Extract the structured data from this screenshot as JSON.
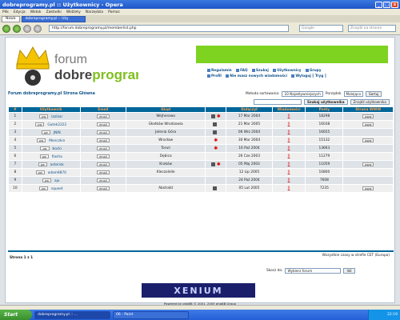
{
  "window": {
    "title": "dobreprogramy.pl :: Użytkownicy - Opera",
    "btn_min": "_",
    "btn_max": "□",
    "btn_close": "x"
  },
  "menu": [
    "Plik",
    "Edycja",
    "Widok",
    "Zakładki",
    "Widżety",
    "Narzędzia",
    "Pomoc"
  ],
  "tabs": [
    {
      "label": "Nowa"
    },
    {
      "label": "dobreprogramy.pl :: Uży"
    }
  ],
  "url": "http://forum.dobreprogramy.pl/memberlist.php",
  "search_placeholder_1": "Google",
  "search_placeholder_2": "Znajdź na stronie",
  "logo": {
    "line1": "forum",
    "line2a": "dobre",
    "line2b": "programy"
  },
  "toplinks": [
    {
      "label": "Regulamin"
    },
    {
      "label": "FAQ"
    },
    {
      "label": "Szukaj"
    },
    {
      "label": "Użytkownicy"
    },
    {
      "label": "Grupy"
    },
    {
      "label": "Profil"
    },
    {
      "label": "Nie masz nowych wiadomości"
    },
    {
      "label": "Wyloguj [ Tryg ]"
    }
  ],
  "site_link": "Forum dobreprogramy.pl Strona Główna",
  "sort": {
    "method_label": "Metoda sortowania:",
    "method_value": "10 Najaktywniejszych",
    "order_label": "Porządek",
    "order_value": "Malejąco",
    "sort_button": "Sortuj"
  },
  "user_search": {
    "button": "Szukaj użytkownika",
    "find_button": "Znajdź użytkownika"
  },
  "table": {
    "headers": [
      "#",
      "Użytkownik",
      "Email",
      "Skąd",
      "",
      "Dołączył",
      "Wiadomości",
      "Posty",
      "Strona WWW"
    ],
    "pm_label": "pw",
    "email_label": "email",
    "www_label": "www",
    "rows": [
      {
        "n": "1",
        "user": "lazikar",
        "from": "Wejherowo",
        "joined": "17 Mar 2004",
        "msgs": "0",
        "posts": "18298",
        "www": true,
        "gg": true,
        "star": true
      },
      {
        "n": "2",
        "user": "Gutek2222",
        "from": "Głodków Wrodzowia",
        "joined": "21 Mar 2005",
        "msgs": "0",
        "posts": "16038",
        "www": true,
        "gg": true,
        "star": false
      },
      {
        "n": "3",
        "user": "JNIN",
        "from": "Jelenia Góra",
        "joined": "06 Wrz 2004",
        "msgs": "0",
        "posts": "16655",
        "www": false,
        "gg": true,
        "star": false
      },
      {
        "n": "4",
        "user": "Monczkin",
        "from": "Wrocław",
        "joined": "30 Mar 2004",
        "msgs": "0",
        "posts": "15132",
        "www": true,
        "gg": false,
        "star": true
      },
      {
        "n": "5",
        "user": "bocki",
        "from": "Toruń",
        "joined": "16 Paź 2004",
        "msgs": "0",
        "posts": "13663",
        "www": false,
        "gg": false,
        "star": true
      },
      {
        "n": "6",
        "user": "fiasha",
        "from": "Dębica",
        "joined": "26 Cze 2003",
        "msgs": "0",
        "posts": "11279",
        "www": false,
        "gg": false,
        "star": false
      },
      {
        "n": "7",
        "user": "asterisk",
        "from": "Kraków",
        "joined": "05 Maj 2003",
        "msgs": "0",
        "posts": "11059",
        "www": true,
        "gg": true,
        "star": true
      },
      {
        "n": "8",
        "user": "adam9870",
        "from": "Kleczolelle",
        "joined": "12 Lip 2005",
        "msgs": "0",
        "posts": "10800",
        "www": false,
        "gg": false,
        "star": false
      },
      {
        "n": "9",
        "user": "aju",
        "from": "",
        "joined": "24 Paź 2004",
        "msgs": "0",
        "posts": "7608",
        "www": false,
        "gg": false,
        "star": false
      },
      {
        "n": "10",
        "user": "squeet",
        "from": "Abstrakt",
        "joined": "05 Lut 2005",
        "msgs": "0",
        "posts": "7235",
        "www": true,
        "gg": true,
        "star": false
      }
    ]
  },
  "timezone": "Wszystkie czasy w strefie CET (Europa)",
  "pages": "Strona 1 z 1",
  "jump": {
    "label": "Skocz do:",
    "value": "Wybierz forum",
    "button": "Idź"
  },
  "banner_text": "XENIUM",
  "powered": "Powered by phpBB © 2001, 2005 phpBB Group",
  "taskbar": {
    "start": "Start",
    "tasks": [
      "dobreprogramy.pl :: ...",
      "06 - Paint"
    ],
    "clock": "22:19"
  },
  "colors": {
    "header_bg": "#006699",
    "header_text": "#ffa34f",
    "banner": "#7ed321",
    "link": "#105289"
  }
}
